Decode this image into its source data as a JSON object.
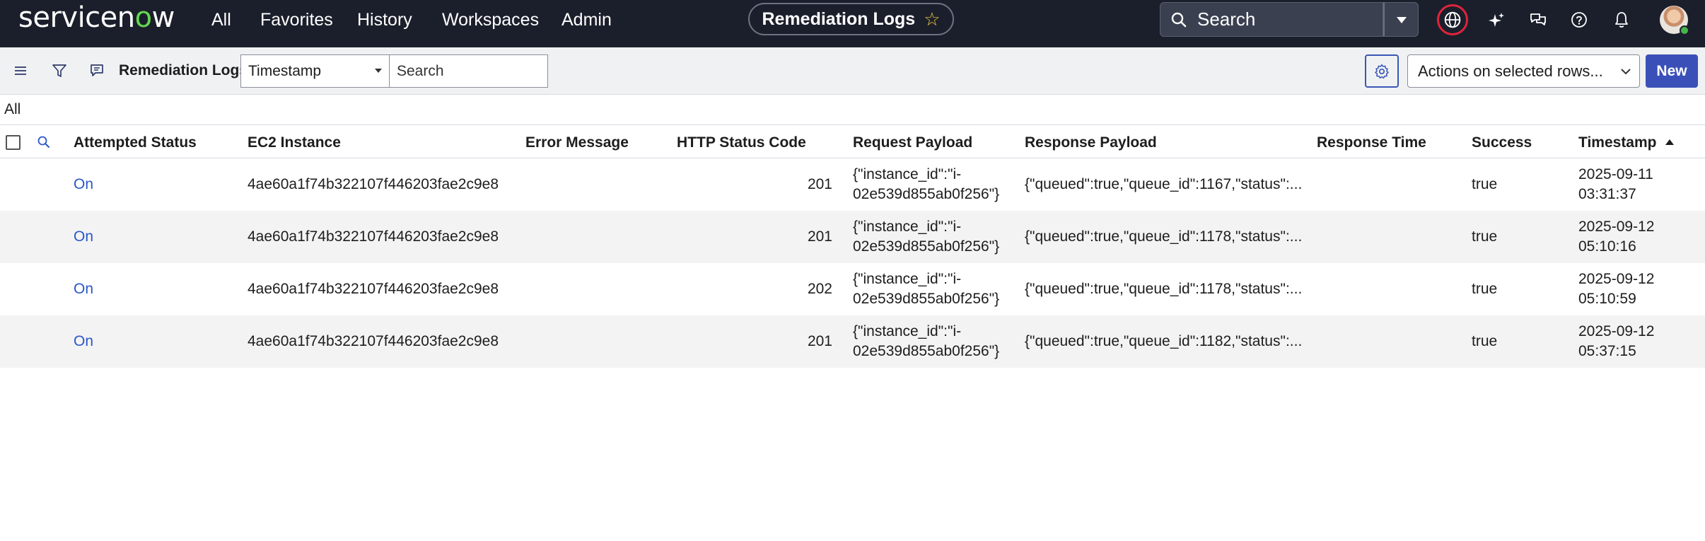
{
  "topnav": {
    "logo_pre": "servicen",
    "logo_o": "o",
    "logo_post": "w",
    "items": [
      "All",
      "Favorites",
      "History",
      "Workspaces",
      "Admin"
    ],
    "context_title": "Remediation Logs",
    "search_placeholder": "Search"
  },
  "listbar": {
    "title": "Remediation Logs",
    "field_select": "Timestamp",
    "search_placeholder": "Search",
    "actions_select": "Actions on selected rows...",
    "new_label": "New"
  },
  "breadcrumb": "All",
  "table": {
    "columns": [
      "Attempted Status",
      "EC2 Instance",
      "Error Message",
      "HTTP Status Code",
      "Request Payload",
      "Response Payload",
      "Response Time",
      "Success",
      "Timestamp"
    ],
    "sorted_column": "Timestamp",
    "sort_direction": "ascending",
    "rows": [
      {
        "attempted_status": "On",
        "ec2_instance": "4ae60a1f74b322107f446203fae2c9e8",
        "error_message": "",
        "http_status_code": "201",
        "request_payload_1": "{\"instance_id\":\"i-",
        "request_payload_2": "02e539d855ab0f256\"}",
        "response_payload": "{\"queued\":true,\"queue_id\":1167,\"status\":...",
        "response_time": "",
        "success": "true",
        "timestamp_date": "2025-09-11",
        "timestamp_time": "03:31:37"
      },
      {
        "attempted_status": "On",
        "ec2_instance": "4ae60a1f74b322107f446203fae2c9e8",
        "error_message": "",
        "http_status_code": "201",
        "request_payload_1": "{\"instance_id\":\"i-",
        "request_payload_2": "02e539d855ab0f256\"}",
        "response_payload": "{\"queued\":true,\"queue_id\":1178,\"status\":...",
        "response_time": "",
        "success": "true",
        "timestamp_date": "2025-09-12",
        "timestamp_time": "05:10:16"
      },
      {
        "attempted_status": "On",
        "ec2_instance": "4ae60a1f74b322107f446203fae2c9e8",
        "error_message": "",
        "http_status_code": "202",
        "request_payload_1": "{\"instance_id\":\"i-",
        "request_payload_2": "02e539d855ab0f256\"}",
        "response_payload": "{\"queued\":true,\"queue_id\":1178,\"status\":...",
        "response_time": "",
        "success": "true",
        "timestamp_date": "2025-09-12",
        "timestamp_time": "05:10:59"
      },
      {
        "attempted_status": "On",
        "ec2_instance": "4ae60a1f74b322107f446203fae2c9e8",
        "error_message": "",
        "http_status_code": "201",
        "request_payload_1": "{\"instance_id\":\"i-",
        "request_payload_2": "02e539d855ab0f256\"}",
        "response_payload": "{\"queued\":true,\"queue_id\":1182,\"status\":...",
        "response_time": "",
        "success": "true",
        "timestamp_date": "2025-09-12",
        "timestamp_time": "05:37:15"
      }
    ]
  },
  "icons": {
    "search": "search-icon",
    "dropdown": "chevron-down-icon",
    "globe": "globe-icon",
    "sparkle": "sparkle-icon",
    "chat": "chat-icon",
    "help": "help-icon",
    "bell": "bell-icon",
    "menu": "hamburger-menu-icon",
    "filter": "filter-icon",
    "list_context": "list-context-icon",
    "gear": "gear-icon",
    "star": "star-icon"
  },
  "colors": {
    "nav_bg": "#1b1f2b",
    "logo_accent": "#62d84e",
    "link": "#2a57c9",
    "primary_button": "#3a50b8",
    "globe_highlight": "#e0243a",
    "star": "#f2c744",
    "row_alt": "#f3f3f4"
  }
}
